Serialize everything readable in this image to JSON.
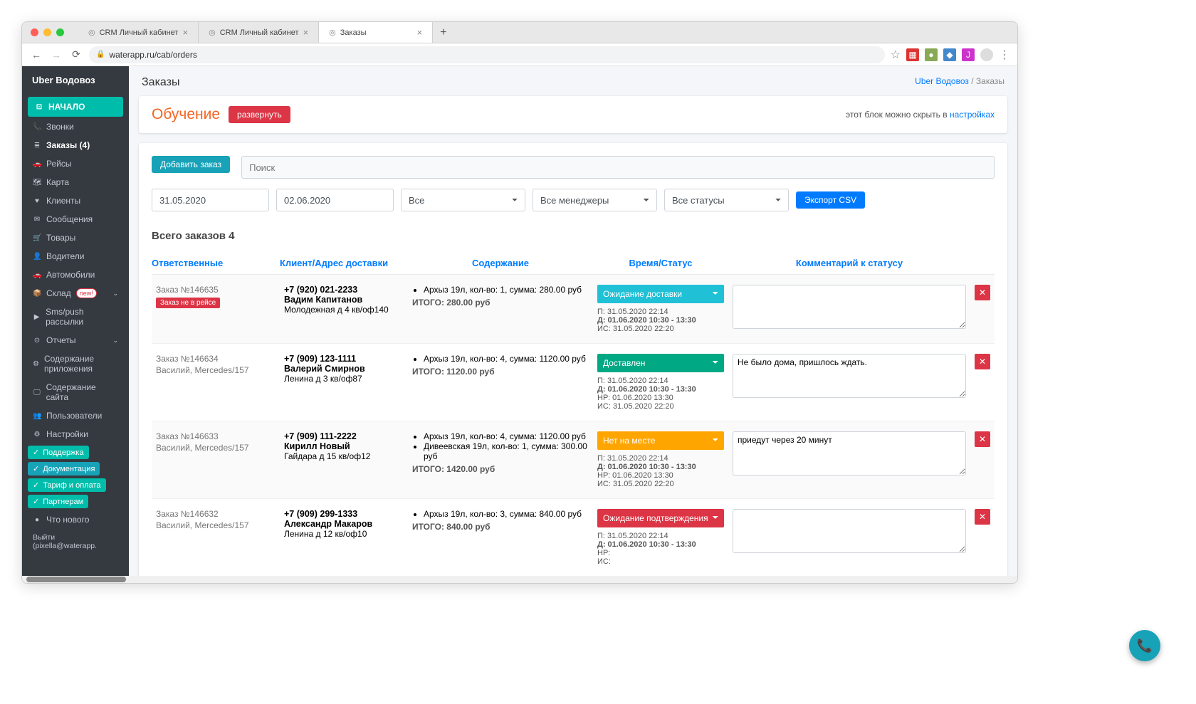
{
  "browser": {
    "tabs": [
      {
        "title": "CRM Личный кабинет",
        "active": false
      },
      {
        "title": "CRM Личный кабинет",
        "active": false
      },
      {
        "title": "Заказы",
        "active": true
      }
    ],
    "url": "waterapp.ru/cab/orders"
  },
  "sidebar": {
    "brand": "Uber Водовоз",
    "home": "НАЧАЛО",
    "items": [
      {
        "icon": "📞",
        "label": "Звонки"
      },
      {
        "icon": "≣",
        "label": "Заказы (4)",
        "bold": true
      },
      {
        "icon": "🚗",
        "label": "Рейсы"
      },
      {
        "icon": "🗺",
        "label": "Карта"
      },
      {
        "icon": "♥",
        "label": "Клиенты"
      },
      {
        "icon": "✉",
        "label": "Сообщения"
      },
      {
        "icon": "🛒",
        "label": "Товары"
      },
      {
        "icon": "👤",
        "label": "Водители"
      },
      {
        "icon": "🚗",
        "label": "Автомобили"
      },
      {
        "icon": "📦",
        "label": "Склад",
        "new": true,
        "caret": true
      },
      {
        "icon": "▶",
        "label": "Sms/push рассылки"
      },
      {
        "icon": "⊙",
        "label": "Отчеты",
        "caret": true
      },
      {
        "icon": "⚙",
        "label": "Содержание приложения"
      },
      {
        "icon": "🖵",
        "label": "Содержание сайта"
      },
      {
        "icon": "👥",
        "label": "Пользователи"
      },
      {
        "icon": "⚙",
        "label": "Настройки"
      }
    ],
    "badges": [
      {
        "label": "Поддержка",
        "color": "green"
      },
      {
        "label": "Документация",
        "color": "blue"
      },
      {
        "label": "Тариф и оплата",
        "color": "green"
      },
      {
        "label": "Партнерам",
        "color": "green"
      }
    ],
    "whatsnew": "Что нового",
    "logout": "Выйти (pixella@waterapp."
  },
  "header": {
    "title": "Заказы",
    "breadcrumb_root": "Uber Водовоз",
    "breadcrumb_current": "Заказы"
  },
  "training": {
    "title": "Обучение",
    "button": "развернуть",
    "hint_prefix": "этот блок можно скрыть в ",
    "hint_link": "настройках"
  },
  "filters": {
    "add_order": "Добавить заказ",
    "search_placeholder": "Поиск",
    "date_from": "31.05.2020",
    "date_to": "02.06.2020",
    "select_all": "Все",
    "select_managers": "Все менеджеры",
    "select_statuses": "Все статусы",
    "export": "Экспорт CSV"
  },
  "orders": {
    "total_label": "Всего заказов 4",
    "columns": {
      "responsible": "Ответственные",
      "client": "Клиент/Адрес доставки",
      "content": "Содержание",
      "status": "Время/Статус",
      "comment": "Комментарий к статусу"
    },
    "rows": [
      {
        "num": "Заказ №146635",
        "badge": "Заказ не в рейсе",
        "driver": "",
        "phone": "+7 (920) 021-2233",
        "name": "Вадим Капитанов",
        "addr": "Молодежная д 4 кв/оф140",
        "items": [
          "Архыз 19л, кол-во: 1, сумма: 280.00 руб"
        ],
        "total": "ИТОГО: 280.00 руб",
        "status": "Ожидание доставки",
        "statusClass": "ss-cyan",
        "times": {
          "p": "П: 31.05.2020 22:14",
          "d": "Д: 01.06.2020 10:30 - 13:30",
          "nr": "",
          "is": "ИС: 31.05.2020 22:20"
        },
        "comment": ""
      },
      {
        "num": "Заказ №146634",
        "driver": "Василий, Mercedes/157",
        "phone": "+7 (909) 123-1111",
        "name": "Валерий Смирнов",
        "addr": "Ленина д 3 кв/оф87",
        "items": [
          "Архыз 19л, кол-во: 4, сумма: 1120.00 руб"
        ],
        "total": "ИТОГО: 1120.00 руб",
        "status": "Доставлен",
        "statusClass": "ss-green",
        "times": {
          "p": "П: 31.05.2020 22:14",
          "d": "Д: 01.06.2020 10:30 - 13:30",
          "nr": "НР: 01.06.2020 13:30",
          "is": "ИС: 31.05.2020 22:20"
        },
        "comment": "Не было дома, пришлось ждать."
      },
      {
        "num": "Заказ №146633",
        "driver": "Василий, Mercedes/157",
        "phone": "+7 (909) 111-2222",
        "name": "Кирилл Новый",
        "addr": "Гайдара д 15 кв/оф12",
        "items": [
          "Архыз 19л, кол-во: 4, сумма: 1120.00 руб",
          "Дивеевская 19л, кол-во: 1, сумма: 300.00 руб"
        ],
        "total": "ИТОГО: 1420.00 руб",
        "status": "Нет на месте",
        "statusClass": "ss-orange",
        "times": {
          "p": "П: 31.05.2020 22:14",
          "d": "Д: 01.06.2020 10:30 - 13:30",
          "nr": "НР: 01.06.2020 13:30",
          "is": "ИС: 31.05.2020 22:20"
        },
        "comment": "приедут через 20 минут"
      },
      {
        "num": "Заказ №146632",
        "driver": "Василий, Mercedes/157",
        "phone": "+7 (909) 299-1333",
        "name": "Александр Макаров",
        "addr": "Ленина д 12 кв/оф10",
        "items": [
          "Архыз 19л, кол-во: 3, сумма: 840.00 руб"
        ],
        "total": "ИТОГО: 840.00 руб",
        "status": "Ожидание подтверждения",
        "statusClass": "ss-red",
        "times": {
          "p": "П: 31.05.2020 22:14",
          "d": "Д: 01.06.2020 10:30 - 13:30",
          "nr": "НР:",
          "is": "ИС:"
        },
        "comment": ""
      }
    ]
  }
}
